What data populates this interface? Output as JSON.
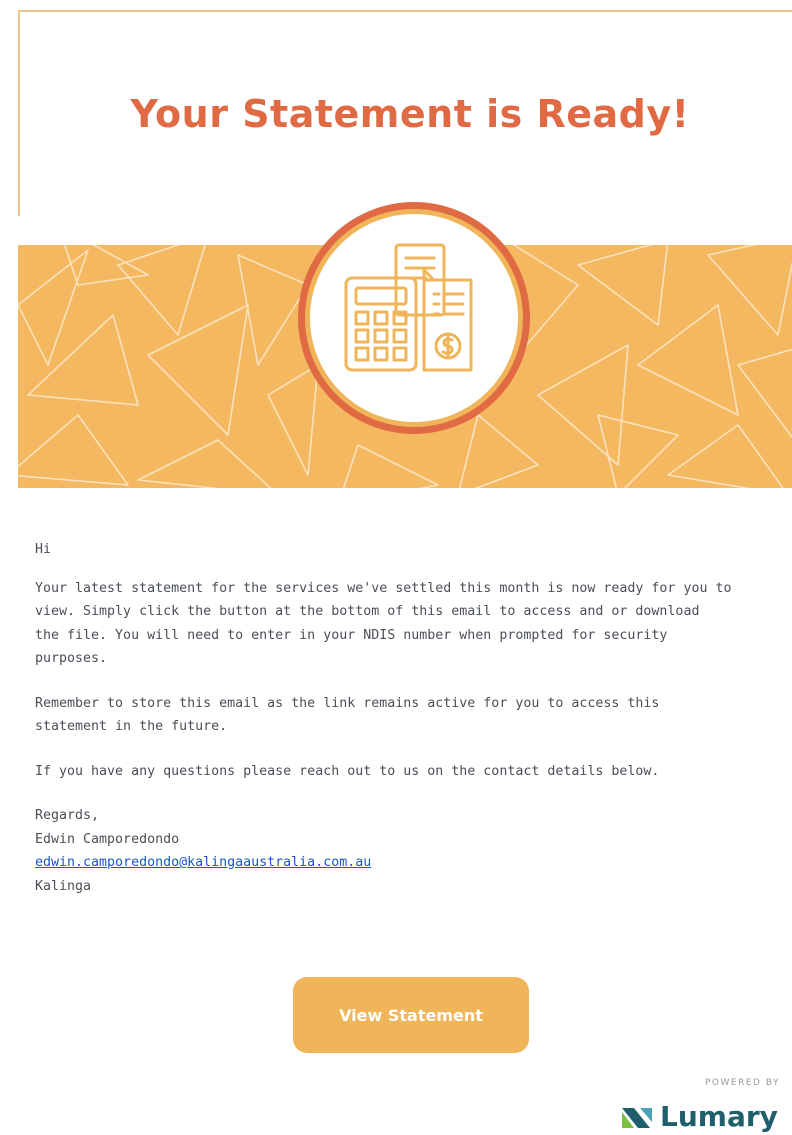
{
  "header": {
    "title": "Your Statement is Ready!"
  },
  "banner": {
    "icon": "calculator-receipt-icon",
    "colors": {
      "banner_bg": "#f4b860",
      "pattern_line": "#fbe2bd",
      "ring_outer": "#e06a43",
      "ring_inner": "#f0b459",
      "icon_stroke": "#f0b459"
    }
  },
  "message": {
    "greeting": "Hi",
    "paragraph1": [
      "Your latest statement for the services we've settled this month is now ready for you to",
      "view. Simply click the button at the bottom of this email to access and or download",
      "the file. You will need to enter in your NDIS number when prompted for security",
      "purposes."
    ],
    "paragraph2": [
      "Remember to store this email as the link remains active for you to access this",
      "statement in the future."
    ],
    "paragraph3": "If you have any questions please reach out to us on the contact details below.",
    "signoff": "Regards,",
    "sender_name": "Edwin Camporedondo",
    "sender_email": "edwin.camporedondo@kalingaaustralia.com.au",
    "organisation": "Kalinga"
  },
  "cta": {
    "label": "View Statement",
    "color": "#f0b459"
  },
  "footer": {
    "powered_by": "POWERED BY",
    "brand": "Lumary",
    "brand_icon": "lumary-logo-icon",
    "brand_color": "#1f5f6b"
  }
}
